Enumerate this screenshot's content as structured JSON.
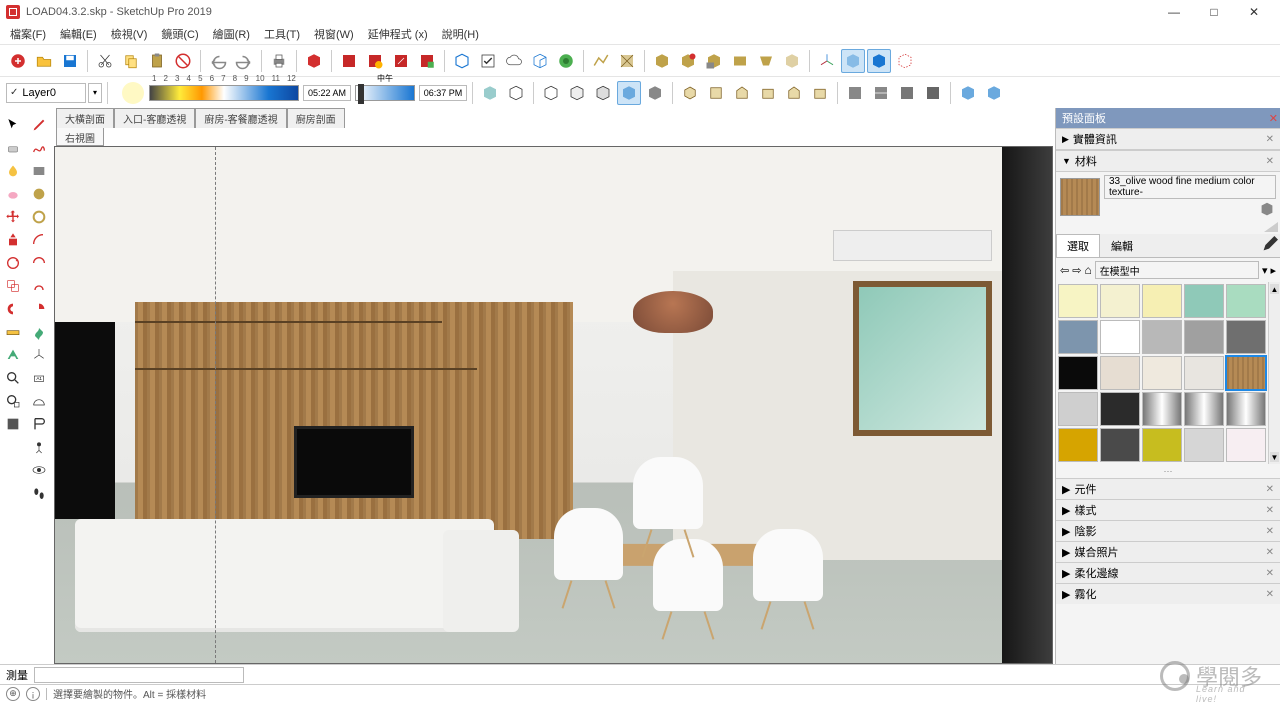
{
  "window": {
    "title": "LOAD04.3.2.skp - SketchUp Pro 2019"
  },
  "menu": [
    "檔案(F)",
    "編輯(E)",
    "檢視(V)",
    "鏡頭(C)",
    "繪圖(R)",
    "工具(T)",
    "視窗(W)",
    "延伸程式 (x)",
    "說明(H)"
  ],
  "layer": {
    "current": "Layer0"
  },
  "shadow": {
    "ticks": [
      "1",
      "2",
      "3",
      "4",
      "5",
      "6",
      "7",
      "8",
      "9",
      "10",
      "11",
      "12"
    ],
    "time_start": "05:22 AM",
    "noon_label": "中午",
    "time_end": "06:37 PM"
  },
  "scenes_row1": [
    "大橫剖面",
    "入口-客廳透視",
    "廚房-客餐廳透視",
    "廚房剖面"
  ],
  "scenes_row2": [
    "右視圖"
  ],
  "panel": {
    "title": "預設面板",
    "sections": {
      "entity": "實體資訊",
      "materials": "材料"
    },
    "material_name": "33_olive wood fine medium color texture-",
    "tabs": {
      "select": "選取",
      "edit": "編輯"
    },
    "location": "在模型中",
    "accordions": [
      "元件",
      "樣式",
      "陰影",
      "媒合照片",
      "柔化邊線",
      "霧化"
    ]
  },
  "swatches": [
    {
      "c": "#f7f4c4"
    },
    {
      "c": "#f4f1d0"
    },
    {
      "c": "#f6efb3"
    },
    {
      "c": "#8fc9b8"
    },
    {
      "c": "#a9dcc0"
    },
    {
      "c": "#7d95ad"
    },
    {
      "c": "#ffffff"
    },
    {
      "c": "#b8b8b8"
    },
    {
      "c": "#a0a0a0"
    },
    {
      "c": "#6f6f6f"
    },
    {
      "c": "#0a0a0a"
    },
    {
      "c": "#e6ddd2"
    },
    {
      "c": "#efe9de"
    },
    {
      "c": "#e8e5e0"
    },
    {
      "c": "wood",
      "sel": true
    },
    {
      "c": "#cfcfcf"
    },
    {
      "c": "#2b2b2b"
    },
    {
      "c": "grad-lr"
    },
    {
      "c": "grad-lr"
    },
    {
      "c": "grad-lr"
    },
    {
      "c": "#d6a400"
    },
    {
      "c": "#4a4a4a"
    },
    {
      "c": "#c7bd1f"
    },
    {
      "c": "#d6d6d6"
    },
    {
      "c": "#f7eef2"
    }
  ],
  "measure": {
    "label": "測量"
  },
  "status": {
    "hint": "選擇要繪製的物件。Alt = 採樣材料"
  },
  "watermark": {
    "main": "學閱多",
    "sub": "Learn and live!"
  }
}
